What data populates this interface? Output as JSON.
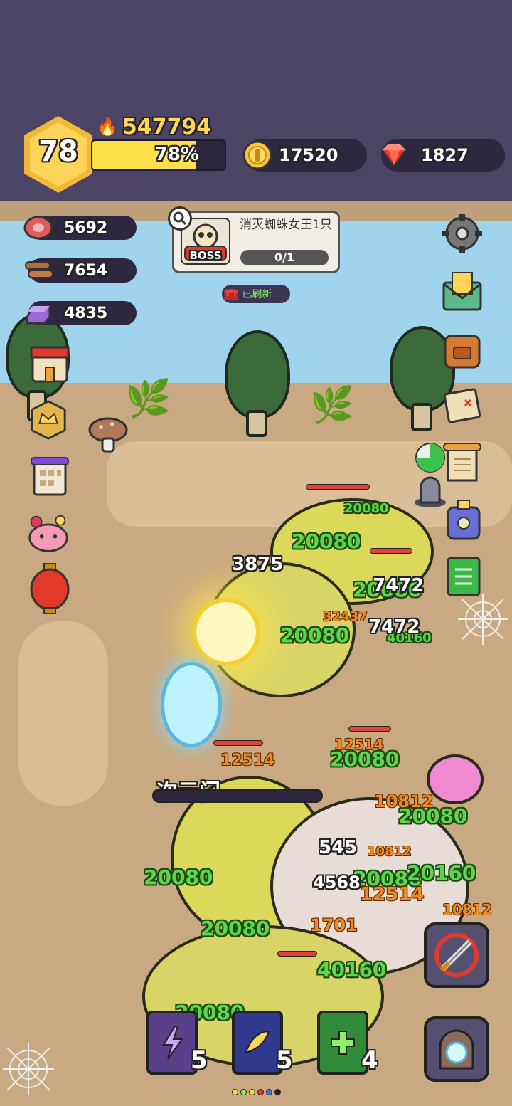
{
  "header": {
    "level": "78",
    "power": "547794",
    "xp_percent_label": "78%",
    "xp_fraction": 0.78,
    "gold": "17520",
    "gems": "1827"
  },
  "resources": [
    {
      "name": "meat",
      "icon": "meat-icon",
      "value": "5692"
    },
    {
      "name": "wood",
      "icon": "wood-icon",
      "value": "7654"
    },
    {
      "name": "crystal",
      "icon": "crystal-ingot-icon",
      "value": "4835"
    }
  ],
  "quest": {
    "boss_badge": "BOSS",
    "title": "消灭蜘蛛女王1只",
    "progress": "0/1",
    "refresh_label": "已刷新"
  },
  "battle": {
    "portal_label": "次元门",
    "damage_numbers_green": [
      "20080",
      "20080",
      "20080",
      "20080",
      "20080",
      "20080",
      "20080",
      "40160",
      "20080",
      "20160",
      "40160",
      "20080",
      "20080",
      "4568"
    ],
    "damage_numbers_white": [
      "3875",
      "7472",
      "7472",
      "545"
    ],
    "damage_numbers_orange": [
      "12514",
      "12514",
      "10812",
      "10812",
      "1701",
      "32437",
      "12514",
      "10812"
    ]
  },
  "skills": [
    {
      "icon": "lightning-book-icon",
      "count": "5",
      "color": "#5a3f8a"
    },
    {
      "icon": "wing-book-icon",
      "count": "5",
      "color": "#2f3a8c"
    },
    {
      "icon": "heal-book-icon",
      "count": "4",
      "color": "#2f8a3a"
    }
  ],
  "colors": {
    "top_bar": "#4c4464",
    "water": "#9fd4ec",
    "ground": "#c9a981",
    "accent_gold": "#ffd45a",
    "damage_green": "#5fd64a"
  }
}
